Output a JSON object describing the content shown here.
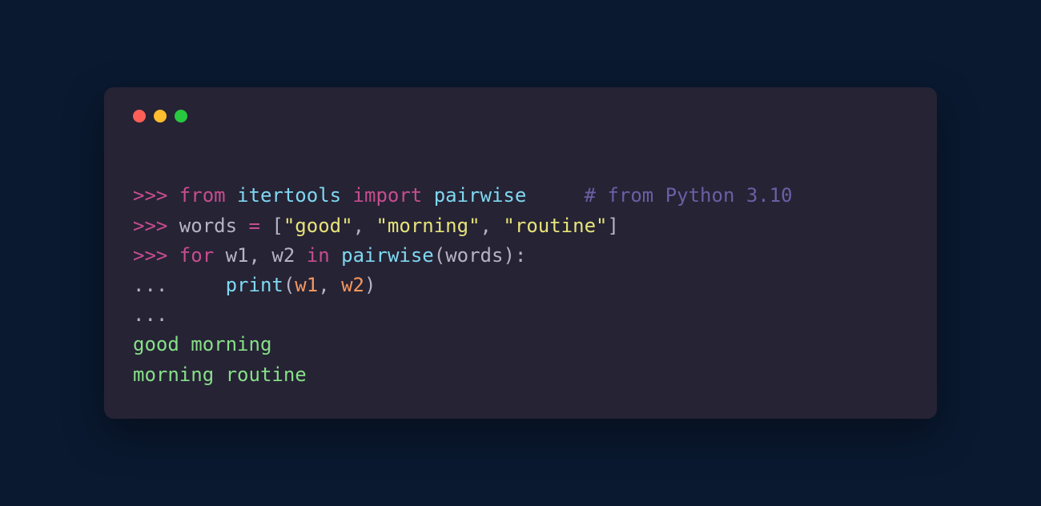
{
  "colors": {
    "bg_outer": "#0a1930",
    "bg_terminal": "#262335",
    "dot_red": "#ff5f57",
    "dot_yellow": "#febc2e",
    "dot_green": "#28c840",
    "prompt": "#c74d8e",
    "keyword": "#c74d8e",
    "module": "#7fd8f0",
    "function": "#7fd8f0",
    "var": "#b6b3c4",
    "string": "#e6e37a",
    "arg": "#f5975e",
    "comment": "#6b5fa4",
    "output": "#87df87"
  },
  "tokens": {
    "prompt": ">>> ",
    "cont": "... ",
    "cont_blank": "...",
    "from": "from",
    "module": "itertools",
    "import": "import",
    "target": "pairwise",
    "comment_pad": "     ",
    "comment": "# from Python 3.10",
    "var": "words",
    "eq": " = ",
    "lbr": "[",
    "s1": "\"good\"",
    "comma1": ", ",
    "s2": "\"morning\"",
    "comma2": ", ",
    "s3": "\"routine\"",
    "rbr": "]",
    "for": "for",
    "w1": "w1",
    "comma_w": ", ",
    "w2": "w2",
    "in": "in",
    "call_func": "pairwise",
    "lpar": "(",
    "call_arg": "words",
    "rpar": "):",
    "indent": "    ",
    "print": "print",
    "p_l": "(",
    "p_a1": "w1",
    "p_c": ", ",
    "p_a2": "w2",
    "p_r": ")"
  },
  "output": {
    "line1": "good morning",
    "line2": "morning routine"
  }
}
